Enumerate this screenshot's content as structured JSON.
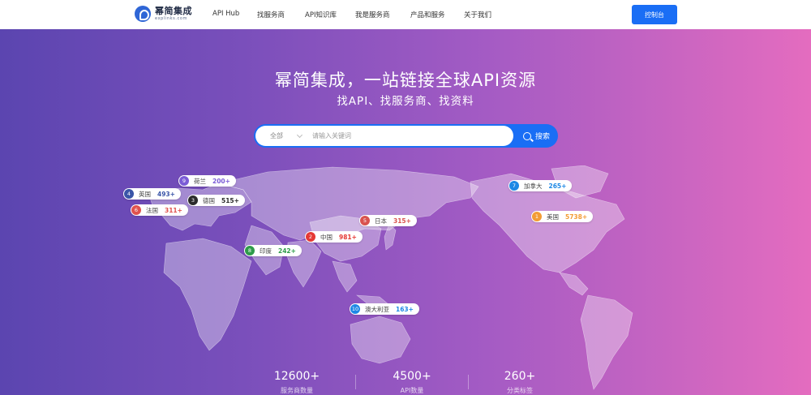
{
  "header": {
    "logo_name": "幂简集成",
    "logo_sub": "explinks.com",
    "nav": [
      "API Hub",
      "找服务商",
      "API知识库",
      "我是服务商",
      "产品和服务",
      "关于我们"
    ],
    "console": "控制台"
  },
  "hero": {
    "title": "幂简集成，一站链接全球API资源",
    "subtitle": "找API、找服务商、找资料"
  },
  "search": {
    "category": "全部",
    "placeholder": "请输入关键词",
    "button": "搜索"
  },
  "pins": [
    {
      "rank": "9",
      "country": "荷兰",
      "count": "200+",
      "color": "#7b5cd6"
    },
    {
      "rank": "4",
      "country": "英国",
      "count": "493+",
      "color": "#3a55a8"
    },
    {
      "rank": "3",
      "country": "德国",
      "count": "515+",
      "color": "#2b2b2b"
    },
    {
      "rank": "6",
      "country": "法国",
      "count": "311+",
      "color": "#e0524e"
    },
    {
      "rank": "2",
      "country": "中国",
      "count": "981+",
      "color": "#e53935"
    },
    {
      "rank": "5",
      "country": "日本",
      "count": "315+",
      "color": "#d9534f"
    },
    {
      "rank": "8",
      "country": "印度",
      "count": "242+",
      "color": "#2e9b4a"
    },
    {
      "rank": "10",
      "country": "澳大利亚",
      "count": "163+",
      "color": "#1e88e5"
    },
    {
      "rank": "7",
      "country": "加拿大",
      "count": "265+",
      "color": "#1e88e5"
    },
    {
      "rank": "1",
      "country": "美国",
      "count": "5738+",
      "color": "#f39c34"
    }
  ],
  "stats": [
    {
      "value": "12600+",
      "label": "服务商数量"
    },
    {
      "value": "4500+",
      "label": "API数量"
    },
    {
      "value": "260+",
      "label": "分类标签"
    }
  ]
}
